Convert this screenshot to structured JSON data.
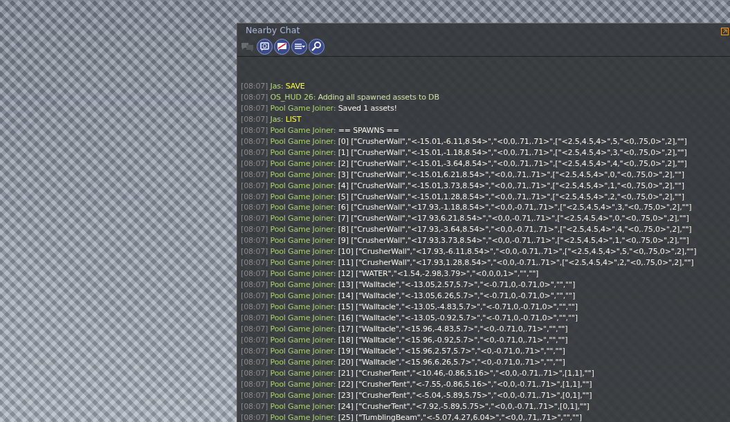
{
  "chat_window": {
    "title": "Nearby Chat",
    "toolbar": [
      {
        "kind": "conversations",
        "disabled": true
      },
      {
        "kind": "history",
        "disabled": false
      },
      {
        "kind": "chat",
        "disabled": false
      },
      {
        "kind": "options",
        "disabled": false
      },
      {
        "kind": "search",
        "disabled": false
      }
    ],
    "messages": [
      {
        "time": "[08:07]",
        "sender": "Jas:",
        "text": "SAVE",
        "kind": "self"
      },
      {
        "time": "[08:07]",
        "sender": "OS_HUD 26:",
        "text": "Adding all spawned assets to DB",
        "kind": "owned-object"
      },
      {
        "time": "[08:07]",
        "sender": "Pool Game Joiner:",
        "text": "Saved 1 assets!",
        "kind": "object"
      },
      {
        "time": "[08:07]",
        "sender": "Jas:",
        "text": "LIST",
        "kind": "self"
      },
      {
        "time": "[08:07]",
        "sender": "Pool Game Joiner:",
        "text": "== SPAWNS ==",
        "kind": "object"
      },
      {
        "time": "[08:07]",
        "sender": "Pool Game Joiner:",
        "text": "[0] [\"CrusherWall\",\"<-15.01,-6.11,8.54>\",\"<0,0,.71,.71>\",[\"<2.5,4.5,4>\",5,\"<0,.75,0>\",2],\"\"]",
        "kind": "object"
      },
      {
        "time": "[08:07]",
        "sender": "Pool Game Joiner:",
        "text": "[1] [\"CrusherWall\",\"<-15.01,-1.18,8.54>\",\"<0,0,.71,.71>\",[\"<2.5,4.5,4>\",3,\"<0,.75,0>\",2],\"\"]",
        "kind": "object"
      },
      {
        "time": "[08:07]",
        "sender": "Pool Game Joiner:",
        "text": "[2] [\"CrusherWall\",\"<-15.01,-3.64,8.54>\",\"<0,0,.71,.71>\",[\"<2.5,4.5,4>\",4,\"<0,.75,0>\",2],\"\"]",
        "kind": "object"
      },
      {
        "time": "[08:07]",
        "sender": "Pool Game Joiner:",
        "text": "[3] [\"CrusherWall\",\"<-15.01,6.21,8.54>\",\"<0,0,.71,.71>\",[\"<2.5,4.5,4>\",0,\"<0,.75,0>\",2],\"\"]",
        "kind": "object"
      },
      {
        "time": "[08:07]",
        "sender": "Pool Game Joiner:",
        "text": "[4] [\"CrusherWall\",\"<-15.01,3.73,8.54>\",\"<0,0,.71,.71>\",[\"<2.5,4.5,4>\",1,\"<0,.75,0>\",2],\"\"]",
        "kind": "object"
      },
      {
        "time": "[08:07]",
        "sender": "Pool Game Joiner:",
        "text": "[5] [\"CrusherWall\",\"<-15.01,1.28,8.54>\",\"<0,0,.71,.71>\",[\"<2.5,4.5,4>\",2,\"<0,.75,0>\",2],\"\"]",
        "kind": "object"
      },
      {
        "time": "[08:07]",
        "sender": "Pool Game Joiner:",
        "text": "[6] [\"CrusherWall\",\"<17.93,-1.18,8.54>\",\"<0,0,-0.71,.71>\",[\"<2.5,4.5,4>\",3,\"<0,.75,0>\",2],\"\"]",
        "kind": "object"
      },
      {
        "time": "[08:07]",
        "sender": "Pool Game Joiner:",
        "text": "[7] [\"CrusherWall\",\"<17.93,6.21,8.54>\",\"<0,0,-0.71,.71>\",[\"<2.5,4.5,4>\",0,\"<0,.75,0>\",2],\"\"]",
        "kind": "object"
      },
      {
        "time": "[08:07]",
        "sender": "Pool Game Joiner:",
        "text": "[8] [\"CrusherWall\",\"<17.93,-3.64,8.54>\",\"<0,0,-0.71,.71>\",[\"<2.5,4.5,4>\",4,\"<0,.75,0>\",2],\"\"]",
        "kind": "object"
      },
      {
        "time": "[08:07]",
        "sender": "Pool Game Joiner:",
        "text": "[9] [\"CrusherWall\",\"<17.93,3.73,8.54>\",\"<0,0,-0.71,.71>\",[\"<2.5,4.5,4>\",1,\"<0,.75,0>\",2],\"\"]",
        "kind": "object"
      },
      {
        "time": "[08:07]",
        "sender": "Pool Game Joiner:",
        "text": "[10] [\"CrusherWall\",\"<17.93,-6.11,8.54>\",\"<0,0,-0.71,.71>\",[\"<2.5,4.5,4>\",5,\"<0,.75,0>\",2],\"\"]",
        "kind": "object"
      },
      {
        "time": "[08:07]",
        "sender": "Pool Game Joiner:",
        "text": "[11] [\"CrusherWall\",\"<17.93,1.28,8.54>\",\"<0,0,-0.71,.71>\",[\"<2.5,4.5,4>\",2,\"<0,.75,0>\",2],\"\"]",
        "kind": "object"
      },
      {
        "time": "[08:07]",
        "sender": "Pool Game Joiner:",
        "text": "[12] [\"WATER\",\"<1.54,-2.98,3.79>\",\"<0,0,0,1>\",\"\",\"\"]",
        "kind": "object"
      },
      {
        "time": "[08:07]",
        "sender": "Pool Game Joiner:",
        "text": "[13] [\"Walltacle\",\"<-13.05,2.57,5.7>\",\"<-0.71,0,-0.71,0>\",\"\",\"\"]",
        "kind": "object"
      },
      {
        "time": "[08:07]",
        "sender": "Pool Game Joiner:",
        "text": "[14] [\"Walltacle\",\"<-13.05,6.26,5.7>\",\"<-0.71,0,-0.71,0>\",\"\",\"\"]",
        "kind": "object"
      },
      {
        "time": "[08:07]",
        "sender": "Pool Game Joiner:",
        "text": "[15] [\"Walltacle\",\"<-13.05,-4.83,5.7>\",\"<-0.71,0,-0.71,0>\",\"\",\"\"]",
        "kind": "object"
      },
      {
        "time": "[08:07]",
        "sender": "Pool Game Joiner:",
        "text": "[16] [\"Walltacle\",\"<-13.05,-0.92,5.7>\",\"<-0.71,0,-0.71,0>\",\"\",\"\"]",
        "kind": "object"
      },
      {
        "time": "[08:07]",
        "sender": "Pool Game Joiner:",
        "text": "[17] [\"Walltacle\",\"<15.96,-4.83,5.7>\",\"<0,-0.71,0,.71>\",\"\",\"\"]",
        "kind": "object"
      },
      {
        "time": "[08:07]",
        "sender": "Pool Game Joiner:",
        "text": "[18] [\"Walltacle\",\"<15.96,-0.92,5.7>\",\"<0,-0.71,0,.71>\",\"\",\"\"]",
        "kind": "object"
      },
      {
        "time": "[08:07]",
        "sender": "Pool Game Joiner:",
        "text": "[19] [\"Walltacle\",\"<15.96,2.57,5.7>\",\"<0,-0.71,0,.71>\",\"\",\"\"]",
        "kind": "object"
      },
      {
        "time": "[08:07]",
        "sender": "Pool Game Joiner:",
        "text": "[20] [\"Walltacle\",\"<15.96,6.26,5.7>\",\"<0,-0.71,0,.71>\",\"\",\"\"]",
        "kind": "object"
      },
      {
        "time": "[08:07]",
        "sender": "Pool Game Joiner:",
        "text": "[21] [\"CrusherTent\",\"<10.46,-0.86,5.16>\",\"<0,0,-0.71,.71>\",[1,1],\"\"]",
        "kind": "object"
      },
      {
        "time": "[08:07]",
        "sender": "Pool Game Joiner:",
        "text": "[22] [\"CrusherTent\",\"<-7.55,-0.86,5.16>\",\"<0,0,-0.71,.71>\",[1,1],\"\"]",
        "kind": "object"
      },
      {
        "time": "[08:07]",
        "sender": "Pool Game Joiner:",
        "text": "[23] [\"CrusherTent\",\"<-5.04,-5.89,5.75>\",\"<0,0,-0.71,.71>\",[0,1],\"\"]",
        "kind": "object"
      },
      {
        "time": "[08:07]",
        "sender": "Pool Game Joiner:",
        "text": "[24] [\"CrusherTent\",\"<7.92,-5.89,5.75>\",\"<0,0,-0.71,.71>\",[0,1],\"\"]",
        "kind": "object"
      },
      {
        "time": "[08:07]",
        "sender": "Pool Game Joiner:",
        "text": "[25] [\"TumblingBeam\",\"<-5.07,4.27,6.04>\",\"<0,0,.71,.71>\",\"\",\"\"]",
        "kind": "object"
      }
    ]
  }
}
